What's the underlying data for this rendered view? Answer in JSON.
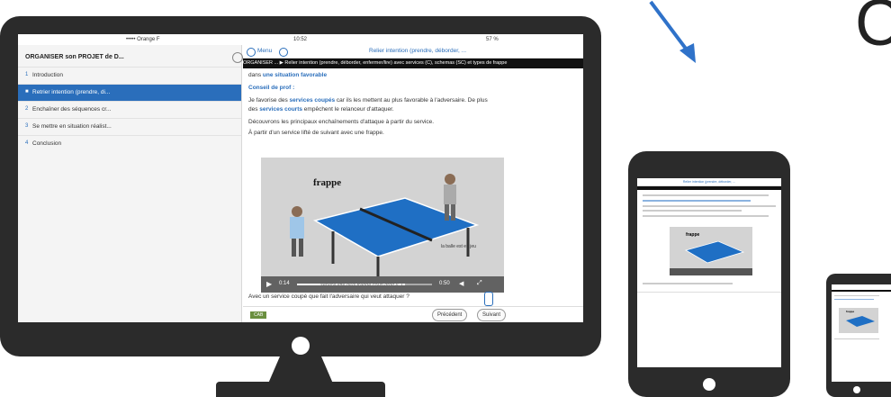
{
  "monitor": {
    "status": {
      "carrier": "••••• Orange F",
      "time": "10:52",
      "battery": "57 %"
    },
    "sidebar": {
      "title": "ORGANISER son PROJET de D...",
      "items": [
        {
          "bullet": "1",
          "label": "Introduction"
        },
        {
          "bullet": "■",
          "label": "Retrier intention (prendre, di..."
        },
        {
          "bullet": "2",
          "label": "Enchaîner des séquences cr..."
        },
        {
          "bullet": "3",
          "label": "Se mettre en situation réalist..."
        },
        {
          "bullet": "4",
          "label": "Conclusion"
        }
      ]
    },
    "topnav": {
      "menu": "Menu",
      "title": "Relier intention (prendre, déborder, ..."
    },
    "breadcrumb": "ORGANISER ... ▶ Relier intention (prendre, déborder, enfermer/lire) avec services (C), schemas (SC) et types de frappe",
    "content": {
      "line1_prefix": "dans ",
      "line1_link": "une situation favorable",
      "advice_heading": "Conseil de prof :",
      "para1_a": "Je favorise des ",
      "para1_b": "services coupés",
      "para1_c": " car ils les mettent au plus favorable à l'adversaire. De plus",
      "para2_a": "des ",
      "para2_b": "services courts",
      "para2_c": " empêchent le relanceur d'attaquer.",
      "para3": "Découvrons les principaux enchaînements d'attaque à partir du service.",
      "para4": "À partir d'un service lifté de suivant avec une frappe.",
      "video_label": "frappe",
      "video_side": "la balle est en jeu",
      "video_time_start": "0:14",
      "video_time_end": "0:50",
      "caption": "service lifté plus frappe coup droit (C)",
      "question": "Avec un service coupé que fait l'adversaire qui veut attaquer ?",
      "tag": "CAB"
    },
    "footer": {
      "prev": "Précédent",
      "next": "Suivant"
    }
  },
  "tablet": {
    "heading": "Relier intention (prendre, déborder, ...",
    "video_label": "frappe"
  },
  "phone": {
    "label": "frappe"
  },
  "colors": {
    "frame": "#2b2b2b",
    "accent": "#2a6ebb",
    "table": "#1f6fc4",
    "arrow": "#2f72c9"
  },
  "decor": {
    "big_letter": "C"
  }
}
